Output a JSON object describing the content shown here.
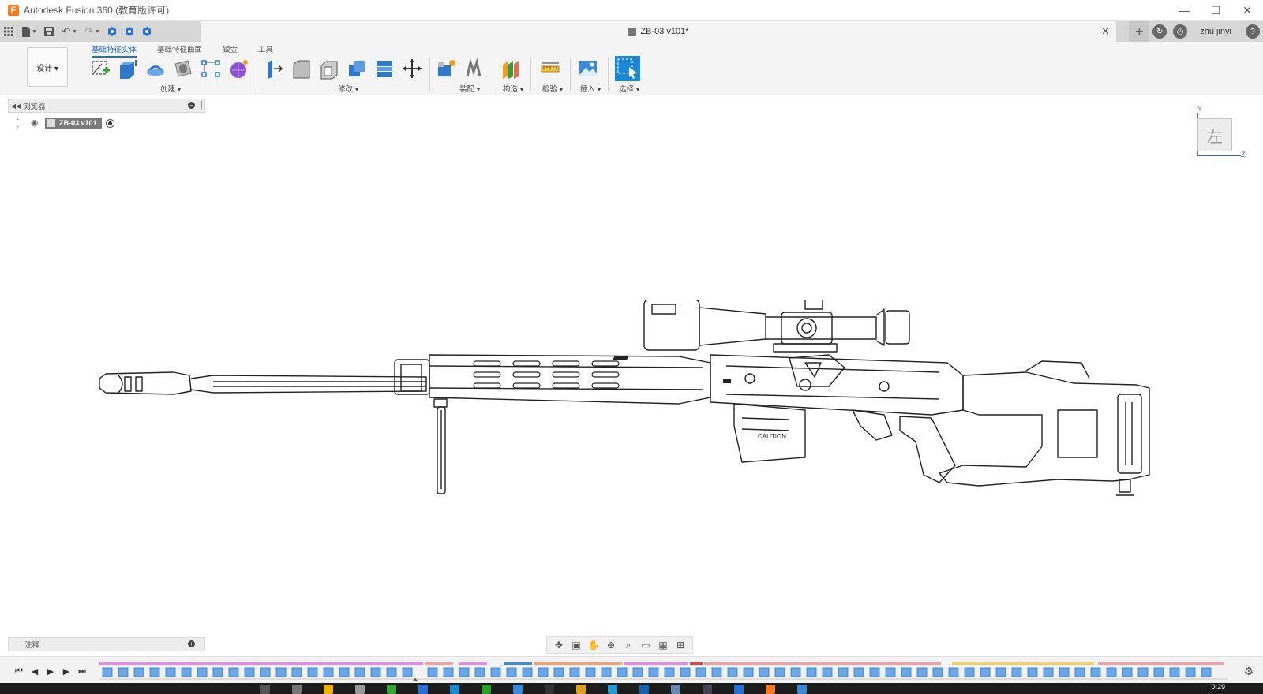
{
  "window": {
    "app_title": "Autodesk Fusion 360 (教育版许可)",
    "logo_letter": "F",
    "controls": [
      "—",
      "☐",
      "✕"
    ]
  },
  "doc_tab": {
    "title": "ZB-03 v101*",
    "close_label": "✕"
  },
  "user": {
    "name": "zhu jinyi",
    "help_label": "?"
  },
  "workspace": {
    "label": "设计 ▾"
  },
  "ribbon": {
    "tabs": [
      {
        "label": "基础特征实体",
        "active": true
      },
      {
        "label": "基础特征曲面",
        "active": false
      },
      {
        "label": "钣金",
        "active": false
      },
      {
        "label": "工具",
        "active": false
      }
    ],
    "groups": [
      "创建 ▾",
      "修改 ▾",
      "装配 ▾",
      "构造 ▾",
      "检验 ▾",
      "插入 ▾",
      "选择 ▾"
    ]
  },
  "browser": {
    "title": "浏览器",
    "component": "ZB-03 v101"
  },
  "viewcube": {
    "face": "左",
    "axis_y": "Y",
    "axis_z": "Z"
  },
  "annotations": {
    "title": "注释"
  },
  "taskbar": {
    "clock": "0:29"
  },
  "colors": {
    "accent": "#1a6fd0",
    "tab_bar": "#d6d6d6",
    "toolbar": "#f4f4f4"
  }
}
